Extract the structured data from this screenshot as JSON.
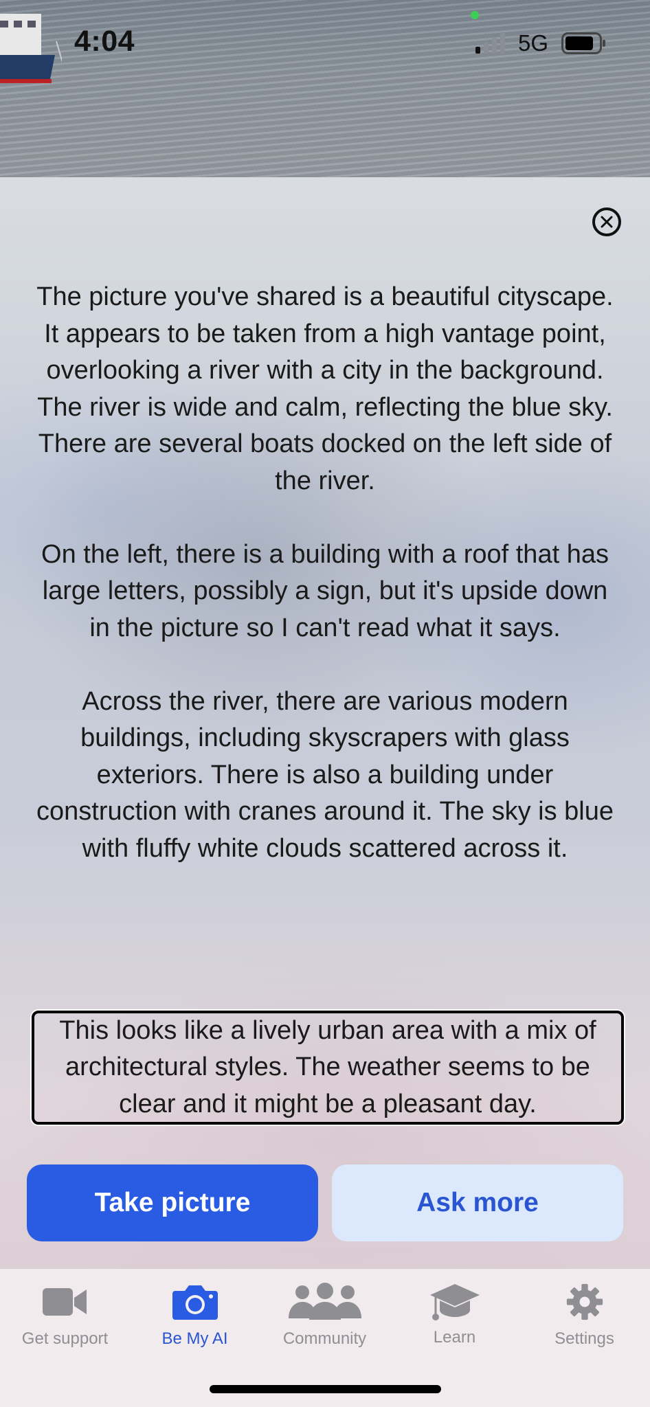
{
  "status_bar": {
    "time": "4:04",
    "network": "5G"
  },
  "description": {
    "paragraphs": [
      "The picture you've shared is a beautiful cityscape. It appears to be taken from a high vantage point, overlooking a river with a city in the background. The river is wide and calm, reflecting the blue sky. There are several boats docked on the left side of the river.",
      "On the left, there is a building with a roof that has large letters, possibly a sign, but it's upside down in the picture so I can't read what it says.",
      "Across the river, there are various modern buildings, including skyscrapers with glass exteriors. There is also a building under construction with cranes around it. The sky is blue with fluffy white clouds scattered across it."
    ],
    "highlighted": "This looks like a lively urban area with a mix of architectural styles. The weather seems to be clear and it might be a pleasant day."
  },
  "actions": {
    "take_picture": "Take picture",
    "ask_more": "Ask more"
  },
  "tab_bar": {
    "items": [
      {
        "label": "Get support",
        "icon": "video-camera-icon"
      },
      {
        "label": "Be My AI",
        "icon": "camera-icon",
        "active": true
      },
      {
        "label": "Community",
        "icon": "people-icon"
      },
      {
        "label": "Learn",
        "icon": "graduation-cap-icon"
      },
      {
        "label": "Settings",
        "icon": "gear-icon"
      }
    ]
  },
  "colors": {
    "accent": "#2a5ce3",
    "secondary_button_bg": "#dce8fb",
    "inactive_tab": "#8e8e93"
  }
}
